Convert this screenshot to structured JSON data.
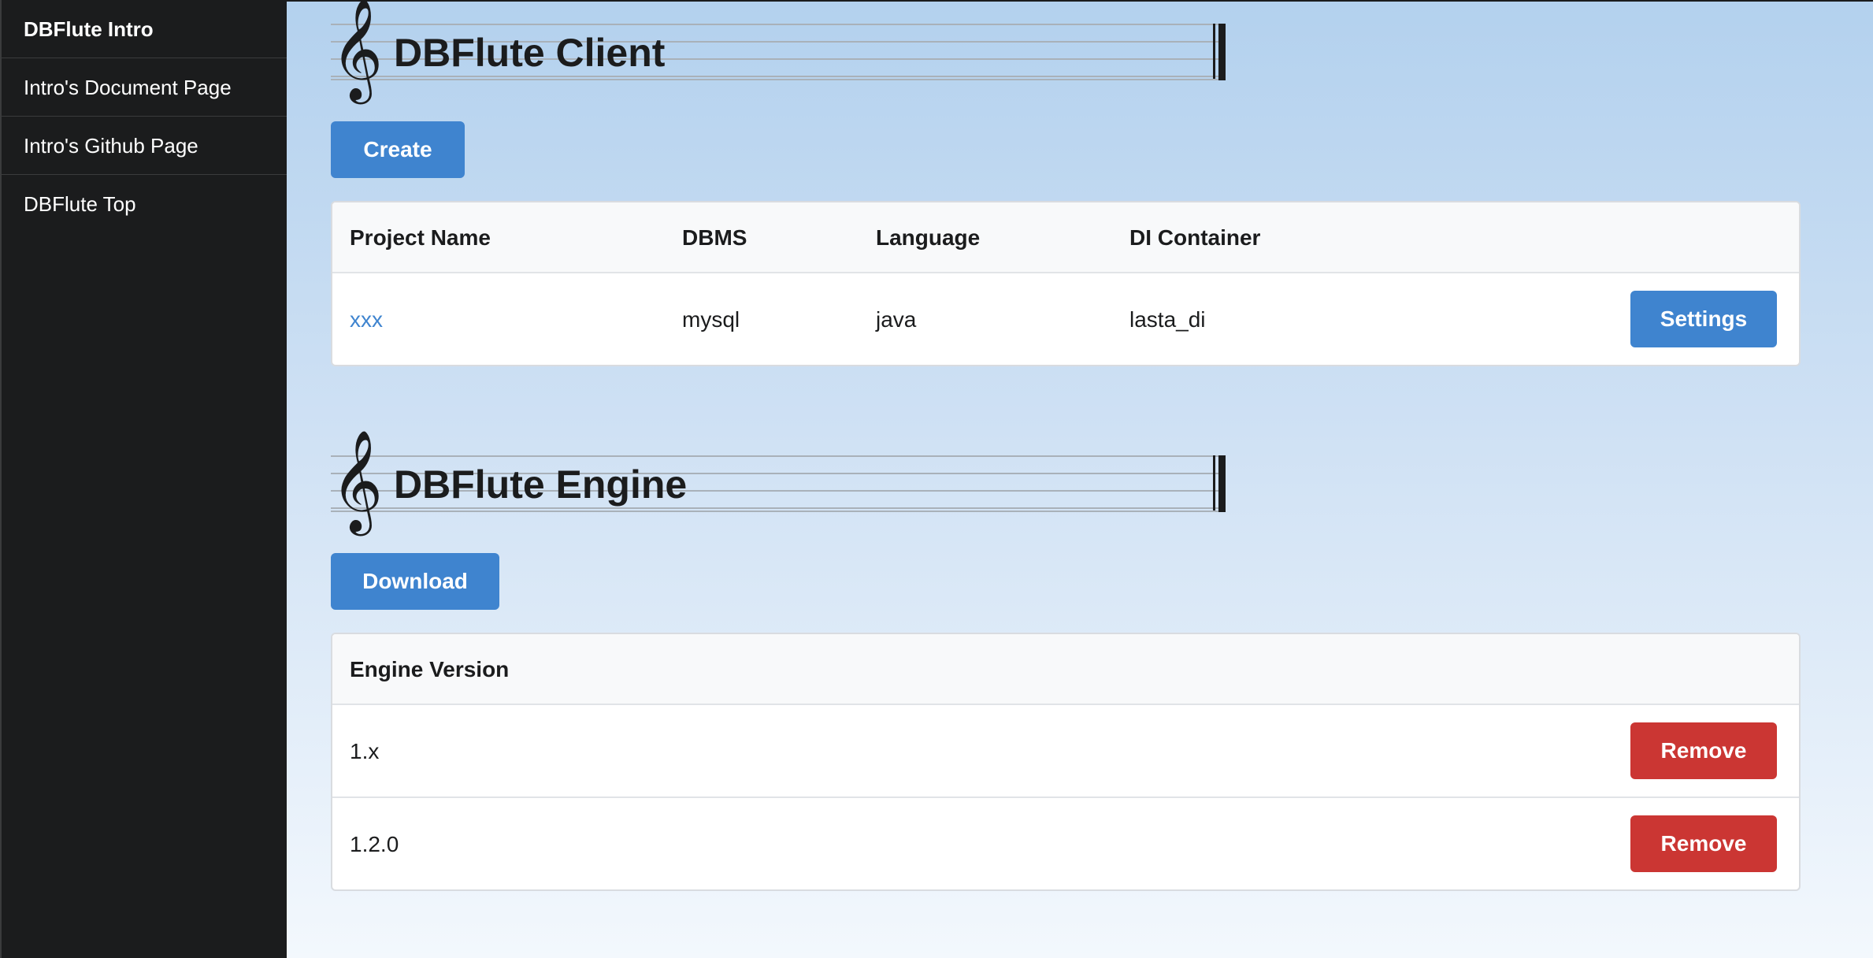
{
  "sidebar": {
    "items": [
      {
        "label": "DBFlute Intro"
      },
      {
        "label": "Intro's Document Page"
      },
      {
        "label": "Intro's Github Page"
      },
      {
        "label": "DBFlute Top"
      }
    ]
  },
  "client_section": {
    "title": "DBFlute Client",
    "clef_icon": "𝄞",
    "create_label": "Create",
    "columns": [
      "Project Name",
      "DBMS",
      "Language",
      "DI Container"
    ],
    "rows": [
      {
        "project_name": "xxx",
        "dbms": "mysql",
        "language": "java",
        "di_container": "lasta_di",
        "action_label": "Settings"
      }
    ]
  },
  "engine_section": {
    "title": "DBFlute Engine",
    "clef_icon": "𝄞",
    "download_label": "Download",
    "columns": [
      "Engine Version"
    ],
    "rows": [
      {
        "version": "1.x",
        "action_label": "Remove"
      },
      {
        "version": "1.2.0",
        "action_label": "Remove"
      }
    ]
  },
  "colors": {
    "sidebar_bg": "#1b1c1d",
    "primary_button": "#3f84cf",
    "danger_button": "#cb3633",
    "link": "#3f84cf"
  }
}
